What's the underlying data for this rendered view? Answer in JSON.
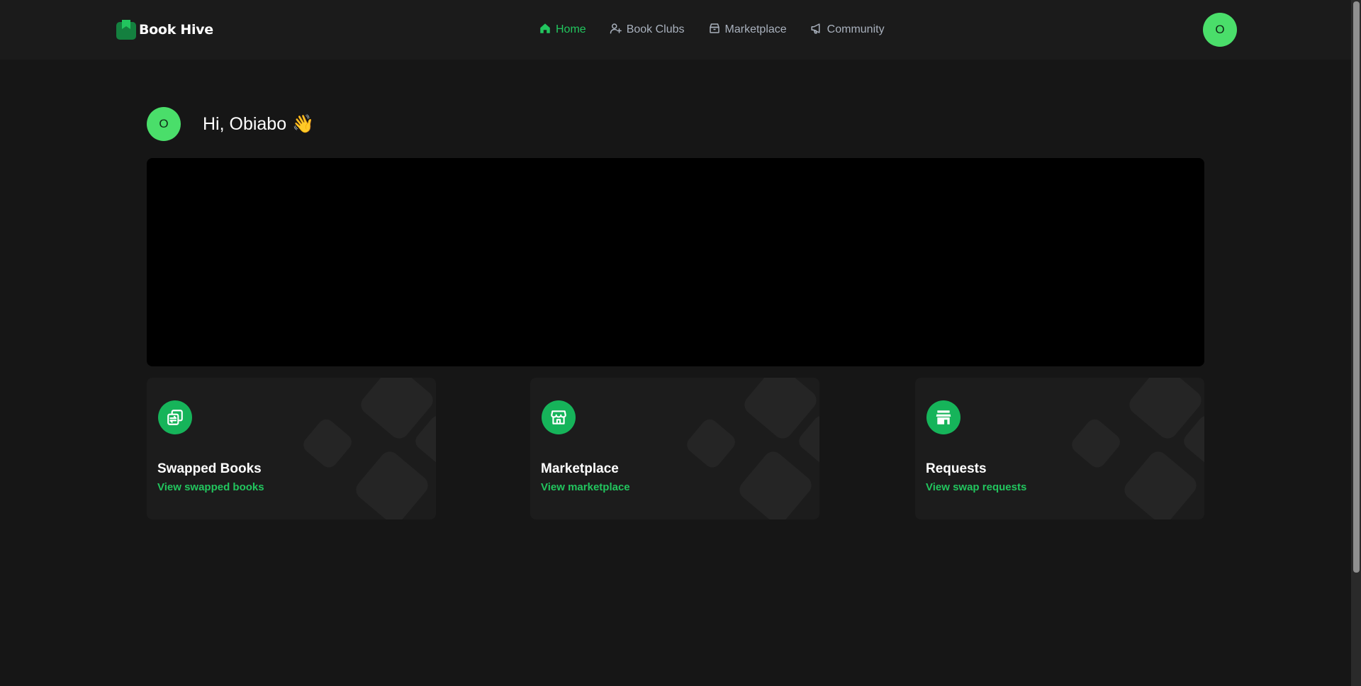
{
  "app": {
    "name": "Book Hive"
  },
  "nav": {
    "items": [
      {
        "label": "Home",
        "icon": "home-icon",
        "active": true
      },
      {
        "label": "Book Clubs",
        "icon": "user-plus-icon",
        "active": false
      },
      {
        "label": "Marketplace",
        "icon": "archive-icon",
        "active": false
      },
      {
        "label": "Community",
        "icon": "megaphone-icon",
        "active": false
      }
    ]
  },
  "user": {
    "initial": "O",
    "greeting": "Hi, Obiabo",
    "wave": "👋"
  },
  "cards": [
    {
      "title": "Swapped Books",
      "link": "View swapped books",
      "icon": "swap-icon"
    },
    {
      "title": "Marketplace",
      "link": "View marketplace",
      "icon": "storefront-icon"
    },
    {
      "title": "Requests",
      "link": "View swap requests",
      "icon": "shop-icon"
    }
  ],
  "colors": {
    "accent": "#22c55e",
    "avatar": "#4ade6a",
    "background": "#161616",
    "nav_text": "#a9b1bd"
  }
}
